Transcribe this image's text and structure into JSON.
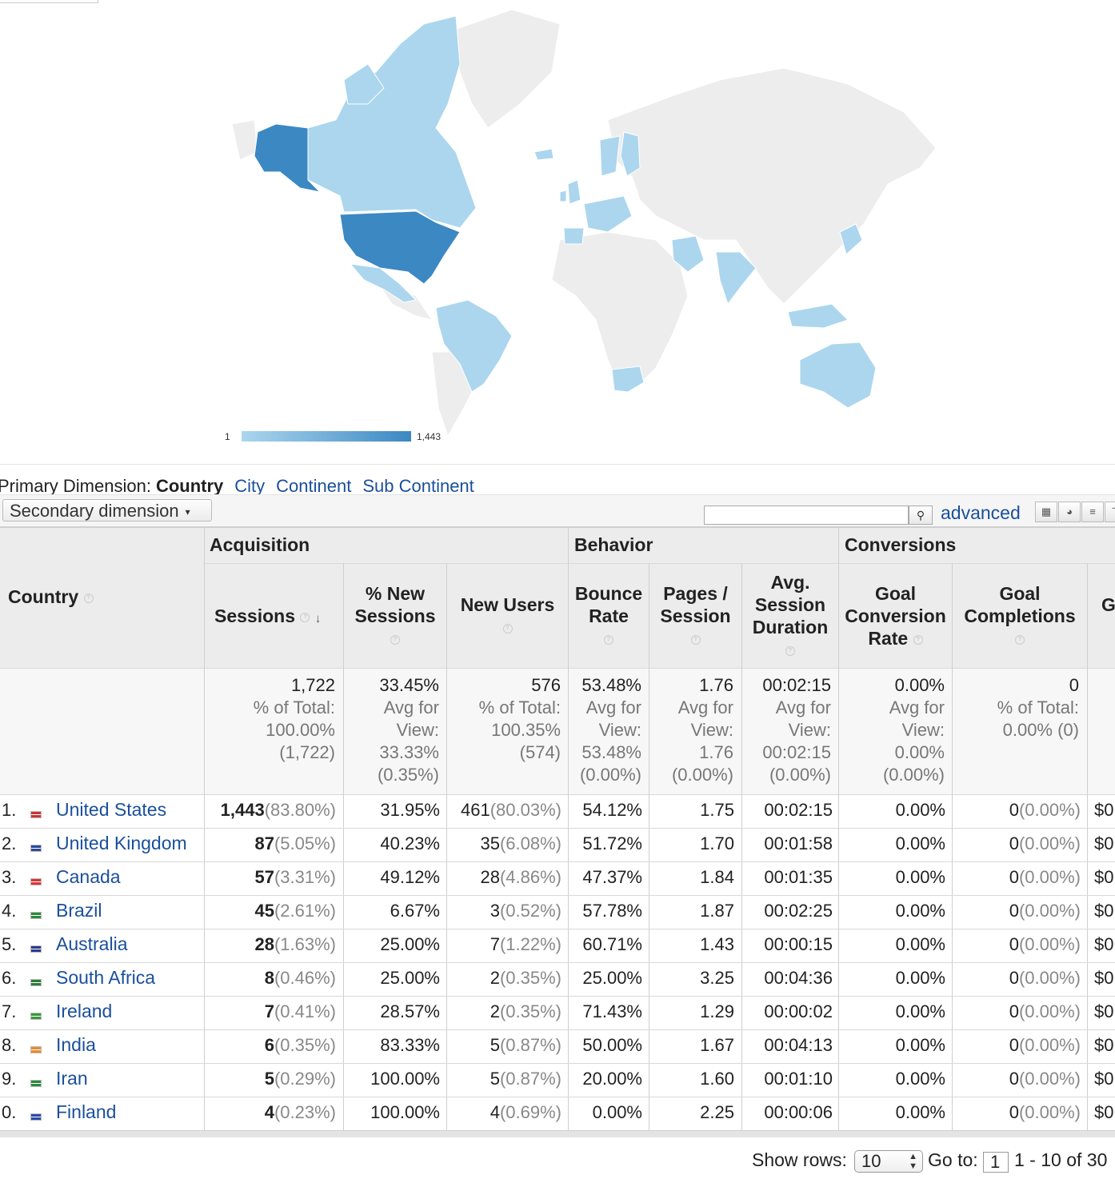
{
  "map": {
    "legend_min": "1",
    "legend_max": "1,443",
    "colors": {
      "high": "#3b88c3",
      "low": "#abd6ee",
      "none": "#ededed"
    }
  },
  "dimension": {
    "label": "Primary Dimension:",
    "current": "Country",
    "options": [
      "City",
      "Continent",
      "Sub Continent"
    ],
    "secondary": "Secondary dimension",
    "advanced": "advanced"
  },
  "groups": {
    "acquisition": "Acquisition",
    "behavior": "Behavior",
    "conversions": "Conversions"
  },
  "headers": {
    "country": "Country",
    "sessions": "Sessions",
    "pct_new_sessions_1": "% New",
    "pct_new_sessions_2": "Sessions",
    "new_users": "New Users",
    "bounce_1": "Bounce",
    "bounce_2": "Rate",
    "pages_1": "Pages /",
    "pages_2": "Session",
    "dur_1": "Avg.",
    "dur_2": "Session",
    "dur_3": "Duration",
    "gcr_1": "Goal",
    "gcr_2": "Conversion",
    "gcr_3": "Rate",
    "gc_1": "Goal",
    "gc_2": "Completions",
    "gv": "G"
  },
  "totals": {
    "sessions": [
      "1,722",
      "% of Total:",
      "100.00%",
      "(1,722)"
    ],
    "pct_new": [
      "33.45%",
      "Avg for",
      "View:",
      "33.33%",
      "(0.35%)"
    ],
    "new_users": [
      "576",
      "% of Total:",
      "100.35%",
      "(574)"
    ],
    "bounce": [
      "53.48%",
      "Avg for",
      "View:",
      "53.48%",
      "(0.00%)"
    ],
    "pages": [
      "1.76",
      "Avg for",
      "View:",
      "1.76",
      "(0.00%)"
    ],
    "duration": [
      "00:02:15",
      "Avg for",
      "View:",
      "00:02:15",
      "(0.00%)"
    ],
    "gcr": [
      "0.00%",
      "Avg for",
      "View:",
      "0.00%",
      "(0.00%)"
    ],
    "gc": [
      "0",
      "% of Total:",
      "0.00% (0)"
    ]
  },
  "rows": [
    {
      "num": "1.",
      "country": "United States",
      "sessions": "1,443",
      "sessions_pct": "(83.80%)",
      "pct_new": "31.95%",
      "new_users": "461",
      "new_users_pct": "(80.03%)",
      "bounce": "54.12%",
      "pages": "1.75",
      "duration": "00:02:15",
      "gcr": "0.00%",
      "gc": "0",
      "gc_pct": "(0.00%)",
      "gv": "$0"
    },
    {
      "num": "2.",
      "country": "United Kingdom",
      "sessions": "87",
      "sessions_pct": "(5.05%)",
      "pct_new": "40.23%",
      "new_users": "35",
      "new_users_pct": "(6.08%)",
      "bounce": "51.72%",
      "pages": "1.70",
      "duration": "00:01:58",
      "gcr": "0.00%",
      "gc": "0",
      "gc_pct": "(0.00%)",
      "gv": "$0"
    },
    {
      "num": "3.",
      "country": "Canada",
      "sessions": "57",
      "sessions_pct": "(3.31%)",
      "pct_new": "49.12%",
      "new_users": "28",
      "new_users_pct": "(4.86%)",
      "bounce": "47.37%",
      "pages": "1.84",
      "duration": "00:01:35",
      "gcr": "0.00%",
      "gc": "0",
      "gc_pct": "(0.00%)",
      "gv": "$0"
    },
    {
      "num": "4.",
      "country": "Brazil",
      "sessions": "45",
      "sessions_pct": "(2.61%)",
      "pct_new": "6.67%",
      "new_users": "3",
      "new_users_pct": "(0.52%)",
      "bounce": "57.78%",
      "pages": "1.87",
      "duration": "00:02:25",
      "gcr": "0.00%",
      "gc": "0",
      "gc_pct": "(0.00%)",
      "gv": "$0"
    },
    {
      "num": "5.",
      "country": "Australia",
      "sessions": "28",
      "sessions_pct": "(1.63%)",
      "pct_new": "25.00%",
      "new_users": "7",
      "new_users_pct": "(1.22%)",
      "bounce": "60.71%",
      "pages": "1.43",
      "duration": "00:00:15",
      "gcr": "0.00%",
      "gc": "0",
      "gc_pct": "(0.00%)",
      "gv": "$0"
    },
    {
      "num": "6.",
      "country": "South Africa",
      "sessions": "8",
      "sessions_pct": "(0.46%)",
      "pct_new": "25.00%",
      "new_users": "2",
      "new_users_pct": "(0.35%)",
      "bounce": "25.00%",
      "pages": "3.25",
      "duration": "00:04:36",
      "gcr": "0.00%",
      "gc": "0",
      "gc_pct": "(0.00%)",
      "gv": "$0"
    },
    {
      "num": "7.",
      "country": "Ireland",
      "sessions": "7",
      "sessions_pct": "(0.41%)",
      "pct_new": "28.57%",
      "new_users": "2",
      "new_users_pct": "(0.35%)",
      "bounce": "71.43%",
      "pages": "1.29",
      "duration": "00:00:02",
      "gcr": "0.00%",
      "gc": "0",
      "gc_pct": "(0.00%)",
      "gv": "$0"
    },
    {
      "num": "8.",
      "country": "India",
      "sessions": "6",
      "sessions_pct": "(0.35%)",
      "pct_new": "83.33%",
      "new_users": "5",
      "new_users_pct": "(0.87%)",
      "bounce": "50.00%",
      "pages": "1.67",
      "duration": "00:04:13",
      "gcr": "0.00%",
      "gc": "0",
      "gc_pct": "(0.00%)",
      "gv": "$0"
    },
    {
      "num": "9.",
      "country": "Iran",
      "sessions": "5",
      "sessions_pct": "(0.29%)",
      "pct_new": "100.00%",
      "new_users": "5",
      "new_users_pct": "(0.87%)",
      "bounce": "20.00%",
      "pages": "1.60",
      "duration": "00:01:10",
      "gcr": "0.00%",
      "gc": "0",
      "gc_pct": "(0.00%)",
      "gv": "$0"
    },
    {
      "num": "0.",
      "country": "Finland",
      "sessions": "4",
      "sessions_pct": "(0.23%)",
      "pct_new": "100.00%",
      "new_users": "4",
      "new_users_pct": "(0.69%)",
      "bounce": "0.00%",
      "pages": "2.25",
      "duration": "00:00:06",
      "gcr": "0.00%",
      "gc": "0",
      "gc_pct": "(0.00%)",
      "gv": "$0"
    }
  ],
  "pager": {
    "show_rows_label": "Show rows:",
    "show_rows_value": "10",
    "goto_label": "Go to:",
    "goto_value": "1",
    "range": "1 - 10 of 30"
  }
}
